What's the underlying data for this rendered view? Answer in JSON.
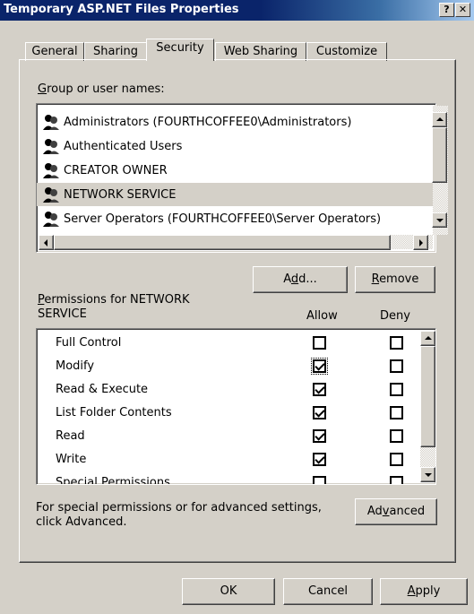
{
  "window": {
    "title": "Temporary ASP.NET Files Properties",
    "help_glyph": "?",
    "close_glyph": "✕"
  },
  "tabs": [
    {
      "label": "General"
    },
    {
      "label": "Sharing"
    },
    {
      "label": "Security"
    },
    {
      "label": "Web Sharing"
    },
    {
      "label": "Customize"
    }
  ],
  "active_tab": "Security",
  "users": {
    "label_pre": "",
    "label_accel": "G",
    "label_post": "roup or user names:",
    "items": [
      {
        "name": "Administrators (FOURTHCOFFEE0\\Administrators)"
      },
      {
        "name": "Authenticated Users"
      },
      {
        "name": "CREATOR OWNER"
      },
      {
        "name": "NETWORK SERVICE"
      },
      {
        "name": "Server Operators (FOURTHCOFFEE0\\Server Operators)"
      }
    ],
    "selected": "NETWORK SERVICE"
  },
  "buttons": {
    "add_pre": "A",
    "add_accel": "d",
    "add_post": "d...",
    "remove_pre": "",
    "remove_accel": "R",
    "remove_post": "emove",
    "advanced_pre": "Ad",
    "advanced_accel": "v",
    "advanced_post": "anced",
    "ok": "OK",
    "cancel": "Cancel",
    "apply_pre": "",
    "apply_accel": "A",
    "apply_post": "pply"
  },
  "permissions": {
    "label_accel": "P",
    "label_line1_post": "ermissions for NETWORK",
    "label_line2": "SERVICE",
    "allow_header": "Allow",
    "deny_header": "Deny",
    "items": [
      {
        "name": "Full Control",
        "allow": false,
        "deny": false
      },
      {
        "name": "Modify",
        "allow": true,
        "deny": false
      },
      {
        "name": "Read & Execute",
        "allow": true,
        "deny": false
      },
      {
        "name": "List Folder Contents",
        "allow": true,
        "deny": false
      },
      {
        "name": "Read",
        "allow": true,
        "deny": false
      },
      {
        "name": "Write",
        "allow": true,
        "deny": false
      },
      {
        "name": "Special Permissions",
        "allow": false,
        "deny": false
      }
    ]
  },
  "advanced_note": {
    "line1": "For special permissions or for advanced settings,",
    "line2": "click Advanced."
  }
}
